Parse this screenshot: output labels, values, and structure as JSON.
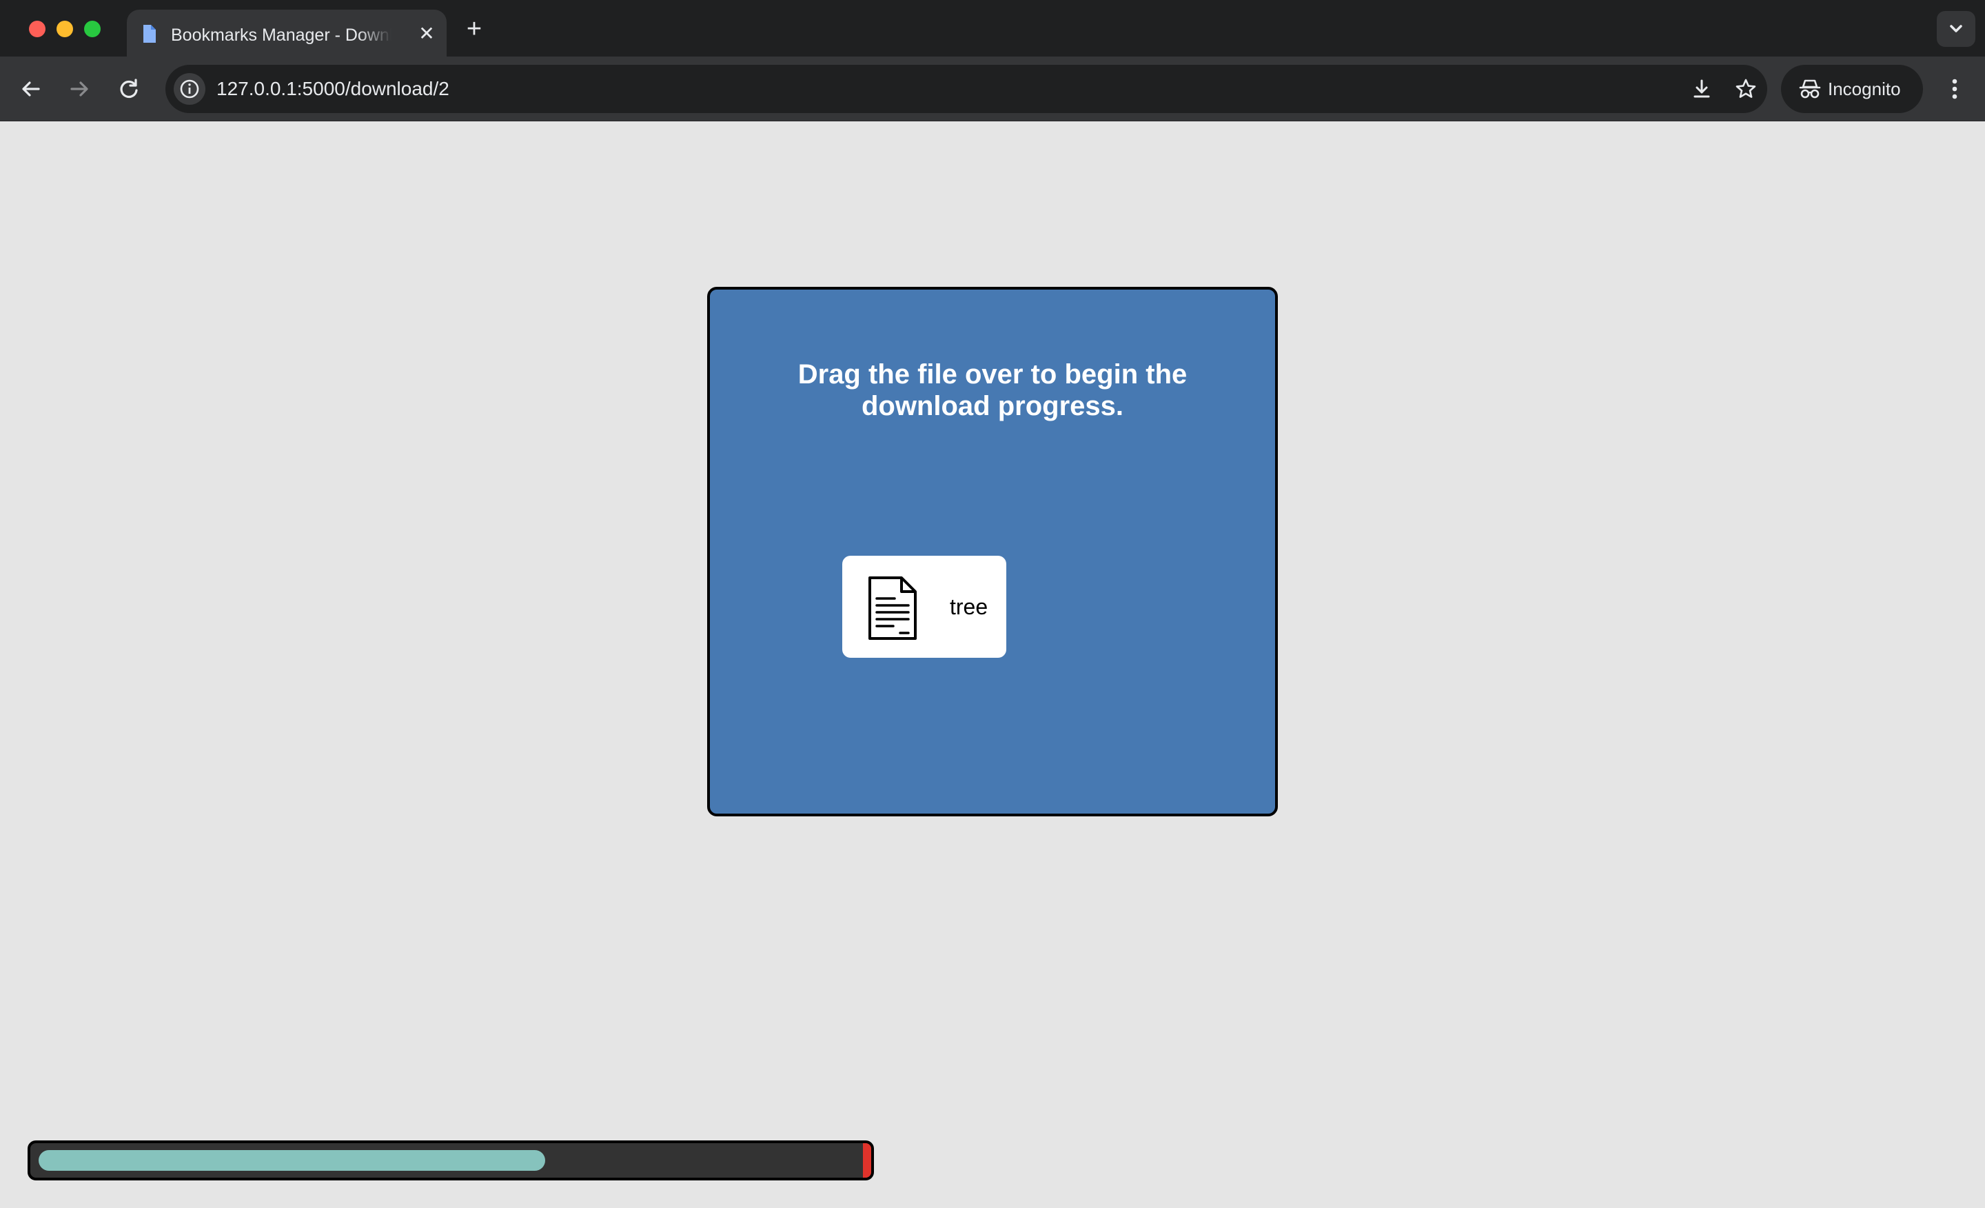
{
  "browser": {
    "tab": {
      "title": "Bookmarks Manager - Download",
      "favicon": "document-icon",
      "close_glyph": "✕"
    },
    "new_tab_glyph": "+",
    "address_bar": {
      "url": "127.0.0.1:5000/download/2"
    },
    "profile": {
      "label": "Incognito"
    }
  },
  "page": {
    "instruction": "Drag the file over to begin the download progress.",
    "file": {
      "name": "tree",
      "icon": "document-icon"
    },
    "progress": {
      "fraction": 0.62,
      "fill_color": "#86c3bd",
      "end_marker_color": "#e0332b",
      "track_color": "#333333"
    },
    "dropzone_color": "#4779b2"
  }
}
